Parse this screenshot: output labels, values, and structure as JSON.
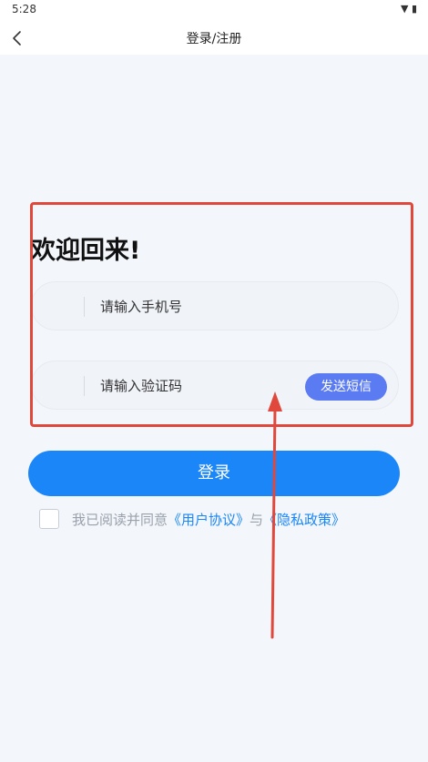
{
  "status_bar": {
    "time": "5:28",
    "icons": "▼ ▮"
  },
  "nav": {
    "title": "登录/注册"
  },
  "welcome": {
    "text": "欢迎回来!"
  },
  "phone_field": {
    "placeholder": "请输入手机号"
  },
  "code_field": {
    "placeholder": "请输入验证码",
    "send_button": "发送短信"
  },
  "login_button": {
    "label": "登录"
  },
  "agreement": {
    "prefix": "我已阅读并同意",
    "user_agreement": "《用户协议》",
    "conjunction": "与",
    "privacy_policy": "《隐私政策》"
  },
  "colors": {
    "accent": "#1a86f7",
    "send_button": "#5a7bf2",
    "annotation": "#e0483b"
  }
}
